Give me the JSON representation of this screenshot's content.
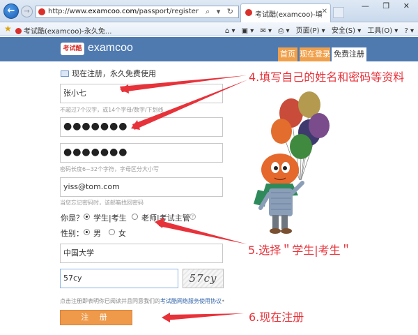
{
  "browser": {
    "address": {
      "prefix": "http://www.",
      "host": "examcoo.com",
      "path": "/passport/register"
    },
    "address_tools": "⌕ ▾ ↻",
    "tab_title": "考试酷(examcoo)-填写注...",
    "window_buttons": "—  ❐  ✕",
    "right_icons": "⌂ ☆ ⚙",
    "favorites_item": "考试酷(examcoo)-永久免...",
    "command_bar": [
      "⌂ ▾",
      "▣ ▾",
      "✉ ▾",
      "⎙ ▾",
      "页面(P) ▾",
      "安全(S) ▾",
      "工具(O) ▾",
      "? ▾"
    ]
  },
  "site": {
    "logo_badge": "考试酷",
    "logo_text": "examcoo",
    "nav": {
      "home": "首页",
      "login": "现在登录",
      "register": "免费注册"
    }
  },
  "form": {
    "title": "现在注册，永久免费使用",
    "name_value": "张小七",
    "name_hint": "不超过7个汉字，或14个字母/数字/下划线",
    "password_value": "●●●●●●●",
    "confirm_value": "●●●●●●●",
    "password_hint": "密码长度6~32个字符，字母区分大小写",
    "email_value": "yiss@tom.com",
    "email_hint": "当您忘记密码时，该邮箱找回密码",
    "role_label": "你是？",
    "role_student": "学生|考生",
    "role_teacher": "老师|考试主管",
    "help_icon": "?",
    "gender_label": "性别：",
    "gender_male": "男",
    "gender_female": "女",
    "school_value": "中国大学",
    "captcha_value": "57cy",
    "captcha_image_text": "57cy",
    "agree_text": "点击注册即表明你已阅读并且同意我们的",
    "agree_link": "考试酷网络服务使用协议",
    "agree_tail": "•",
    "submit_label": "注 册"
  },
  "annotations": {
    "step4": "4.填写自己的姓名和密码等资料",
    "step5": "5.选择＂学生|考生＂",
    "step6": "6.现在注册"
  },
  "colors": {
    "header": "#4f7ab0",
    "accent": "#f0a04b",
    "annotation": "#e8323a"
  }
}
